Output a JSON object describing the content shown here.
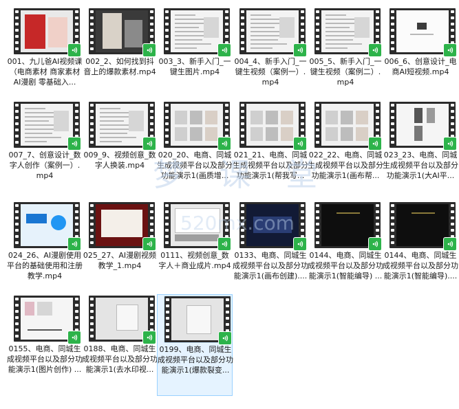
{
  "files": [
    {
      "label": "001、九儿爸AI视频课（电商素材 商家素材 AI漫剧 零基础入..."
    },
    {
      "label": "002_2、如何找到抖音上的爆款素材.mp4"
    },
    {
      "label": "003_3、新手入门_一键生图片.mp4"
    },
    {
      "label": "004_4、新手入门_一键生视频（案例一）.mp4"
    },
    {
      "label": "005_5、新手入门_一键生视频（案例二）.mp4"
    },
    {
      "label": "006_6、创意设计_电商AI短视频.mp4"
    },
    {
      "label": "007_7、创意设计_数字人创作（案例一）.mp4"
    },
    {
      "label": "009_9、视频创意_数字人换装.mp4"
    },
    {
      "label": "020_20、电商、同城生成视频平台以及部分功能演示1(画质增..."
    },
    {
      "label": "021_21、电商、同城生成视频平台以及部分功能演示1(帮我写..."
    },
    {
      "label": "022_22、电商、同城生成视频平台以及部分功能演示1(画布帮..."
    },
    {
      "label": "023_23、电商、同城生成视频平台以及部分功能演示1(大AI平..."
    },
    {
      "label": "024_26、AI漫剧使用平台的基础使用和注册教学.mp4"
    },
    {
      "label": "025_27、AI漫剧视频教学_1.mp4"
    },
    {
      "label": "0111、视频创意_数字人＋商业成片.mp4"
    },
    {
      "label": "0133、电商、同城生成视频平台以及部分功能演示1(画布创建)...."
    },
    {
      "label": "0144、电商、同城生成视频平台以及部分功能演示1(智能编导) ..."
    },
    {
      "label": "0144、电商、同城生成视频平台以及部分功能演示1(智能编导)...."
    },
    {
      "label": "0155、电商、同城生成视频平台以及部分功能演示1(图片创作) ..."
    },
    {
      "label": "0188、电商、同城生成视频平台以及部分功能演示1(去水印视..."
    },
    {
      "label": "0199、电商、同城生成视频平台以及部分功能演示1(爆款裂变..."
    }
  ],
  "badge_icon": "wechat-video-icon",
  "colors": {
    "badge": "#2db34a",
    "film": "#2b2b2b",
    "selection": "#e5f3ff"
  },
  "watermarks": {
    "main": "梦 课 堂",
    "site": "520mx.com"
  }
}
